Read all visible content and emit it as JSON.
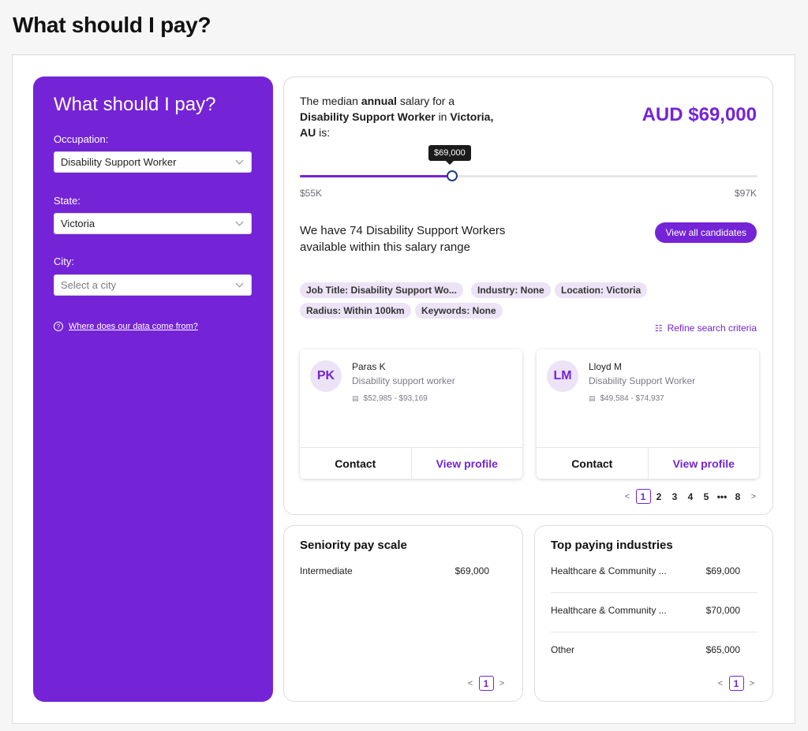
{
  "page": {
    "title": "What should I pay?"
  },
  "sidebar": {
    "title": "What should I pay?",
    "occupation": {
      "label": "Occupation:",
      "value": "Disability Support Worker"
    },
    "state": {
      "label": "State:",
      "value": "Victoria"
    },
    "city": {
      "label": "City:",
      "placeholder": "Select a city"
    },
    "data_link": "Where does our data come from?"
  },
  "salary": {
    "intro": "The median",
    "period": "annual",
    "intro2": "salary for a",
    "occupation": "Disability Support Worker",
    "in": "in",
    "location": "Victoria, AU",
    "is": "is:",
    "median": "AUD $69,000",
    "tooltip": "$69,000",
    "min_label": "$55K",
    "max_label": "$97K",
    "min": 55000,
    "max": 97000,
    "value": 69000,
    "available_text": "We have 74 Disability Support Workers available within this salary range",
    "view_all_label": "View all candidates",
    "refine_label": "Refine search criteria"
  },
  "chips": [
    "Job Title: Disability Support Wo...",
    "Industry: None",
    "Location: Victoria",
    "Radius: Within 100km",
    "Keywords: None"
  ],
  "candidates": [
    {
      "initials": "PK",
      "name": "Paras K",
      "title": "Disability support worker",
      "range": "$52,985 - $93,169",
      "contact": "Contact",
      "profile": "View profile"
    },
    {
      "initials": "LM",
      "name": "Lloyd M",
      "title": "Disability Support Worker",
      "range": "$49,584 - $74,937",
      "contact": "Contact",
      "profile": "View profile"
    }
  ],
  "candidate_pager": {
    "prev": "<",
    "pages": [
      "1",
      "2",
      "3",
      "4",
      "5",
      "•••",
      "8"
    ],
    "next": ">",
    "active": "1"
  },
  "seniority": {
    "title": "Seniority pay scale",
    "rows": [
      {
        "label": "Intermediate",
        "value": "$69,000"
      }
    ],
    "pager": {
      "prev": "<",
      "page": "1",
      "next": ">"
    }
  },
  "industries": {
    "title": "Top paying industries",
    "rows": [
      {
        "label": "Healthcare & Community ...",
        "value": "$69,000"
      },
      {
        "label": "Healthcare & Community ...",
        "value": "$70,000"
      },
      {
        "label": "Other",
        "value": "$65,000"
      }
    ],
    "pager": {
      "prev": "<",
      "page": "1",
      "next": ">"
    }
  },
  "colors": {
    "accent": "#7424d6",
    "chip_bg": "#ece3f6",
    "thumb_border": "#1d3e78"
  },
  "icons": {
    "help": "question-circle-icon",
    "chevron": "chevron-down-icon",
    "refine": "sliders-icon",
    "money": "money-icon"
  }
}
